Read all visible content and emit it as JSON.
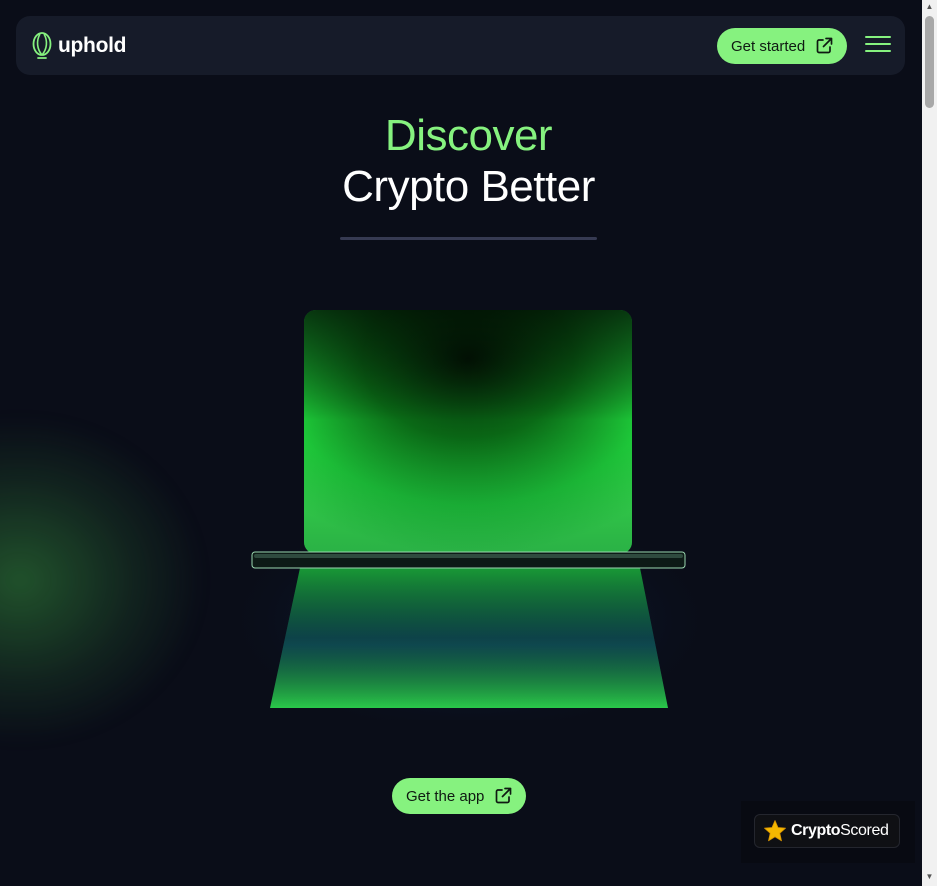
{
  "header": {
    "brand": "uphold",
    "cta_label": "Get started",
    "menu_icon": "hamburger-menu-icon"
  },
  "hero": {
    "line1": "Discover",
    "line2": "Crypto Better"
  },
  "app_button": {
    "label": "Get the app"
  },
  "badge": {
    "brand_bold": "Crypto",
    "brand_light": "Scored",
    "icon": "star-icon"
  },
  "colors": {
    "accent": "#86f27f",
    "background": "#0a0d18",
    "header_bg": "#161b29"
  }
}
